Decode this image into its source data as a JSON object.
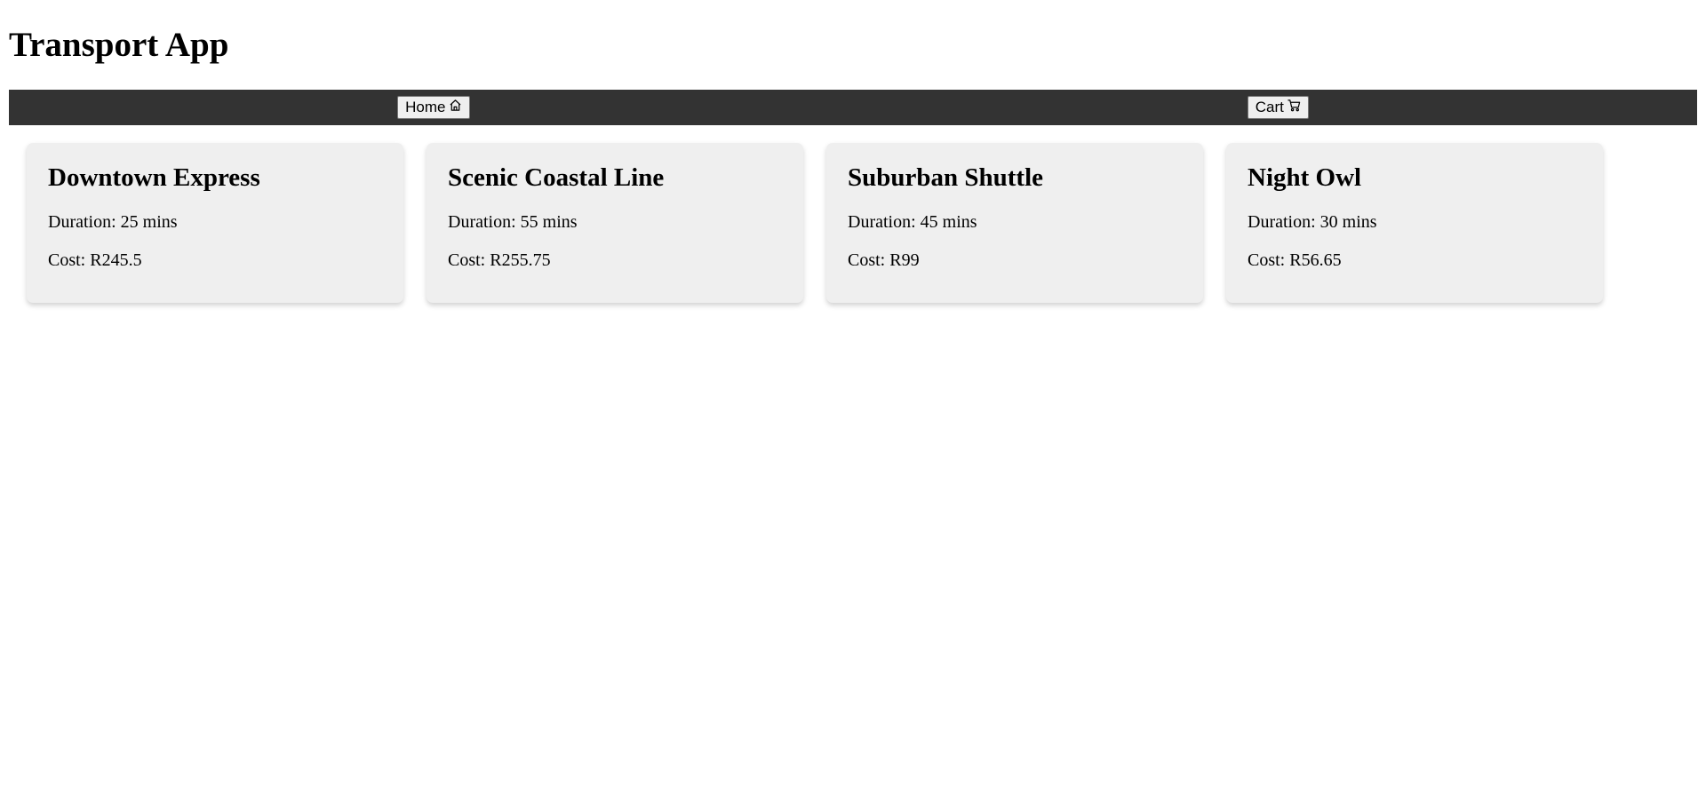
{
  "app": {
    "title": "Transport App"
  },
  "nav": {
    "home_label": "Home",
    "home_icon": "home-icon",
    "cart_label": "Cart",
    "cart_icon": "cart-icon"
  },
  "colors": {
    "navbar": "#333333",
    "card_background": "#efefef"
  },
  "routes": [
    {
      "name": "Downtown Express",
      "duration": "Duration: 25 mins",
      "cost": "Cost: R245.5"
    },
    {
      "name": "Scenic Coastal Line",
      "duration": "Duration: 55 mins",
      "cost": "Cost: R255.75"
    },
    {
      "name": "Suburban Shuttle",
      "duration": "Duration: 45 mins",
      "cost": "Cost: R99"
    },
    {
      "name": "Night Owl",
      "duration": "Duration: 30 mins",
      "cost": "Cost: R56.65"
    }
  ]
}
